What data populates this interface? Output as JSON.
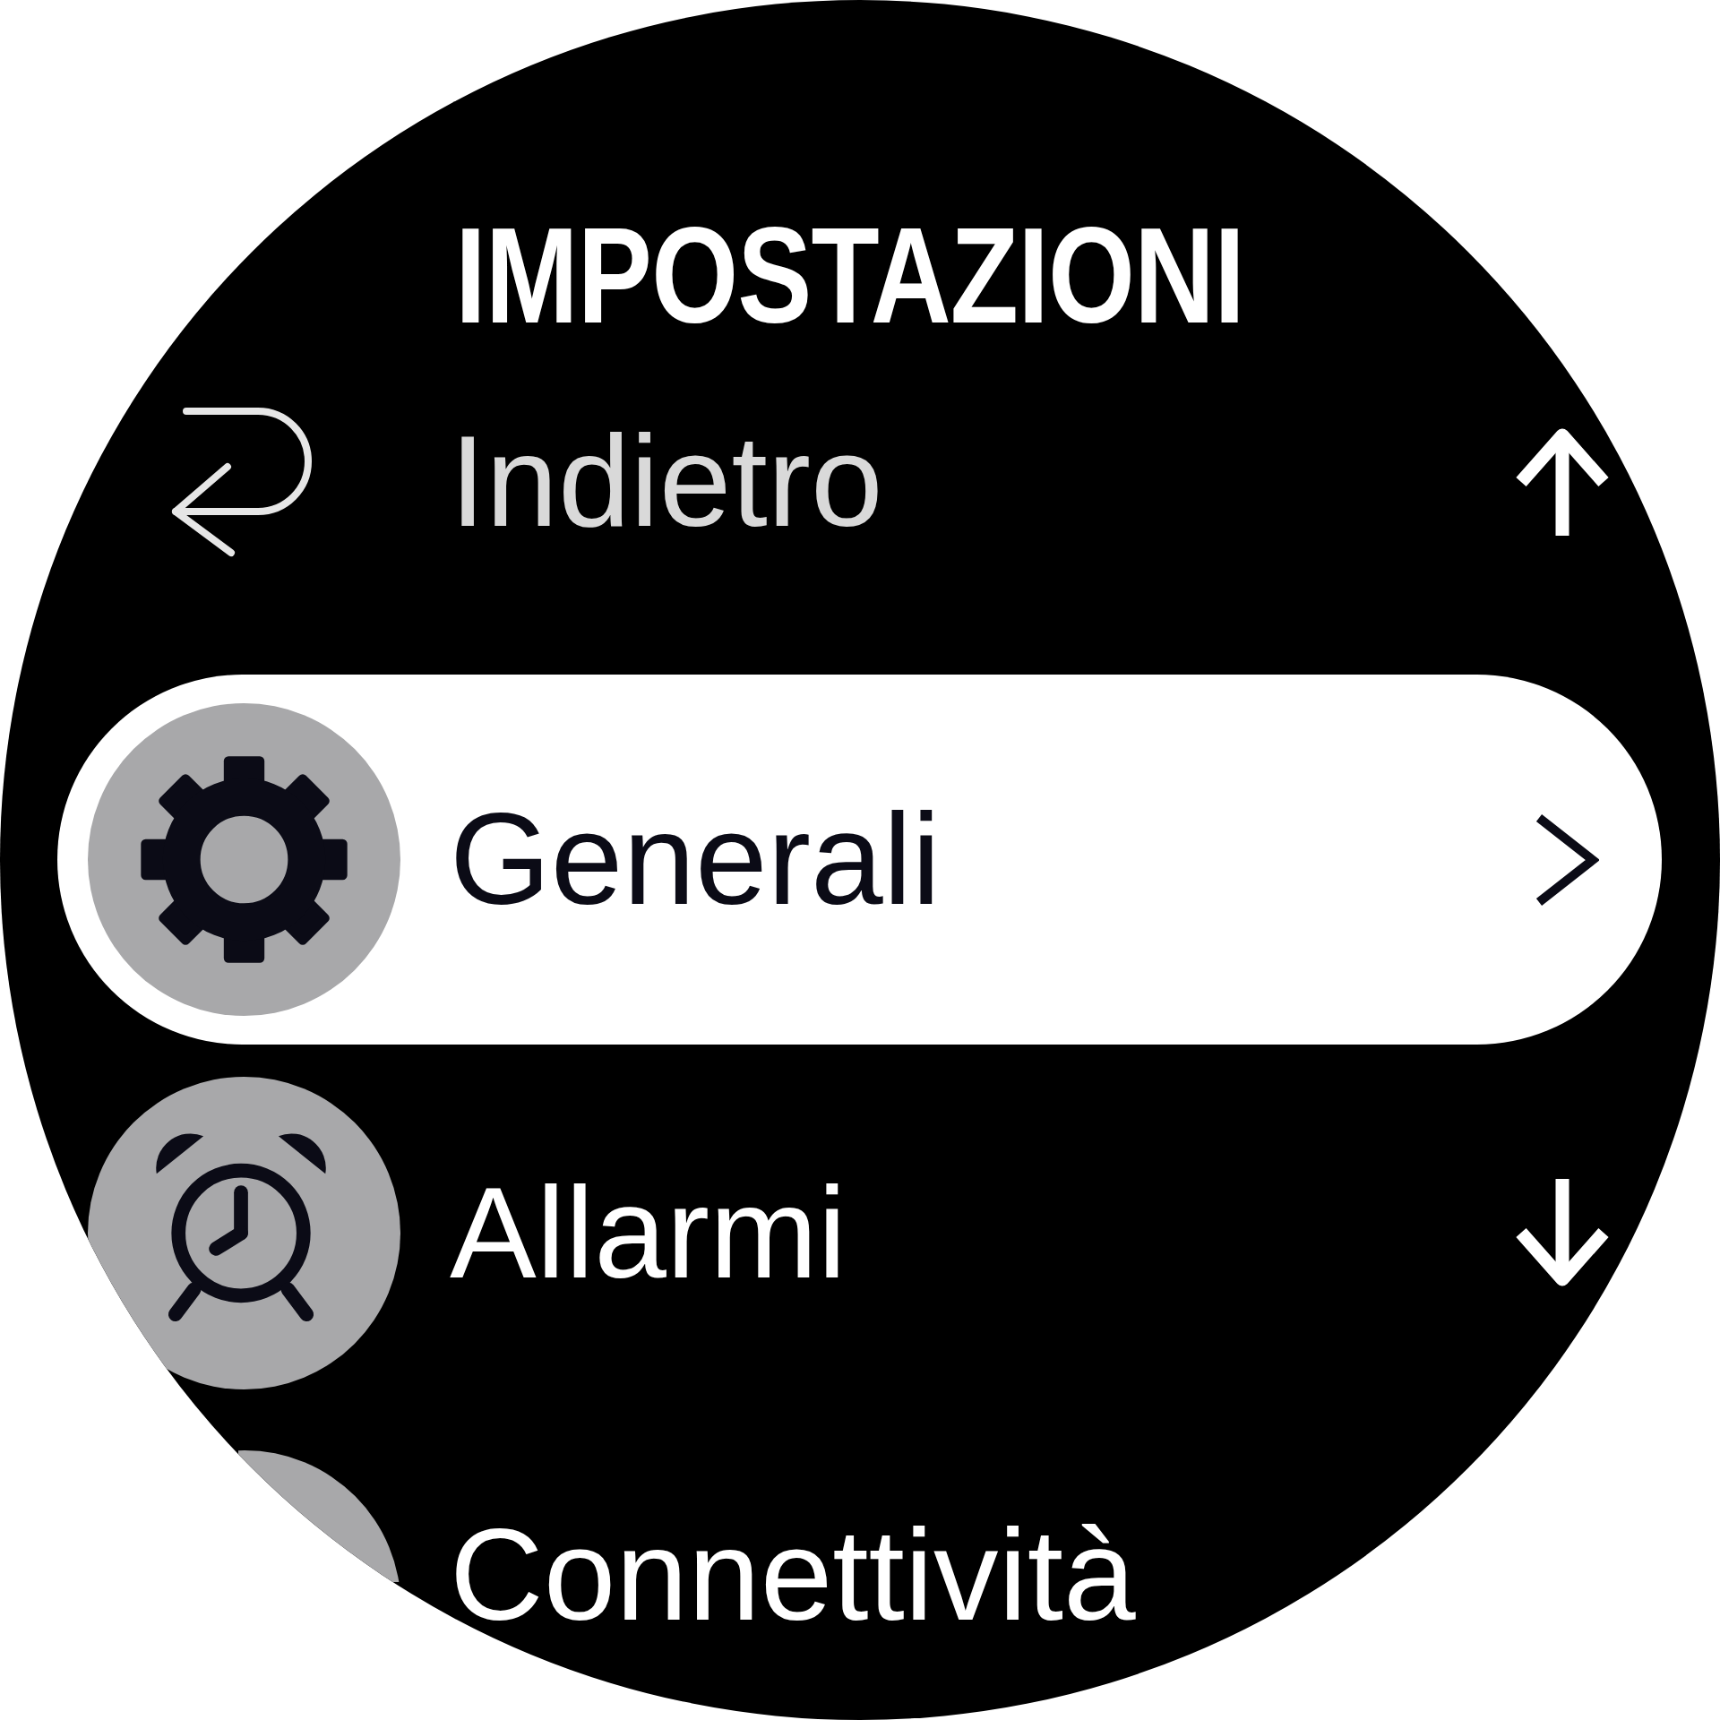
{
  "screen": {
    "title": "IMPOSTAZIONI"
  },
  "menu": {
    "items": [
      {
        "kind": "back",
        "label": "Indietro",
        "selected": false
      },
      {
        "kind": "gear",
        "label": "Generali",
        "selected": true
      },
      {
        "kind": "alarm",
        "label": "Allarmi",
        "selected": false
      },
      {
        "kind": "disc",
        "label": "Connettività",
        "selected": false
      }
    ]
  }
}
